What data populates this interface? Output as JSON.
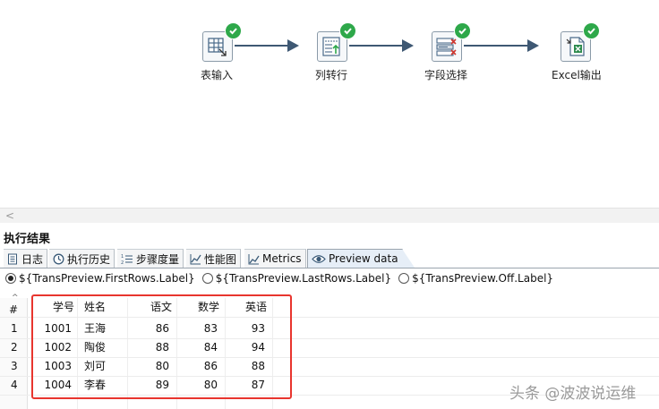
{
  "canvas": {
    "steps": [
      {
        "name": "表输入",
        "icon": "table-input-icon"
      },
      {
        "name": "列转行",
        "icon": "row-normaliser-icon"
      },
      {
        "name": "字段选择",
        "icon": "select-values-icon"
      },
      {
        "name": "Excel输出",
        "icon": "excel-output-icon"
      }
    ],
    "status_icon": "success-check-icon"
  },
  "results": {
    "title": "执行结果",
    "tabs": [
      {
        "label": "日志",
        "icon": "log-icon"
      },
      {
        "label": "执行历史",
        "icon": "history-icon"
      },
      {
        "label": "步骤度量",
        "icon": "step-metrics-icon"
      },
      {
        "label": "性能图",
        "icon": "performance-graph-icon"
      },
      {
        "label": "Metrics",
        "icon": "metrics-icon"
      },
      {
        "label": "Preview data",
        "icon": "eye-icon",
        "active": true
      }
    ],
    "radios": [
      {
        "label": "${TransPreview.FirstRows.Label}",
        "selected": true
      },
      {
        "label": "${TransPreview.LastRows.Label}",
        "selected": false
      },
      {
        "label": "${TransPreview.Off.Label}",
        "selected": false
      }
    ]
  },
  "table": {
    "rownum_header": "#",
    "columns": [
      "学号",
      "姓名",
      "语文",
      "数学",
      "英语"
    ],
    "rows": [
      {
        "n": "1",
        "cells": [
          "1001",
          "王海",
          "86",
          "83",
          "93"
        ]
      },
      {
        "n": "2",
        "cells": [
          "1002",
          "陶俊",
          "88",
          "84",
          "94"
        ]
      },
      {
        "n": "3",
        "cells": [
          "1003",
          "刘可",
          "80",
          "86",
          "88"
        ]
      },
      {
        "n": "4",
        "cells": [
          "1004",
          "李春",
          "89",
          "80",
          "87"
        ]
      }
    ]
  },
  "watermark": "头条 @波波说运维",
  "colors": {
    "success": "#2ea84a",
    "highlight": "#e8352e",
    "hop": "#3e5873"
  }
}
